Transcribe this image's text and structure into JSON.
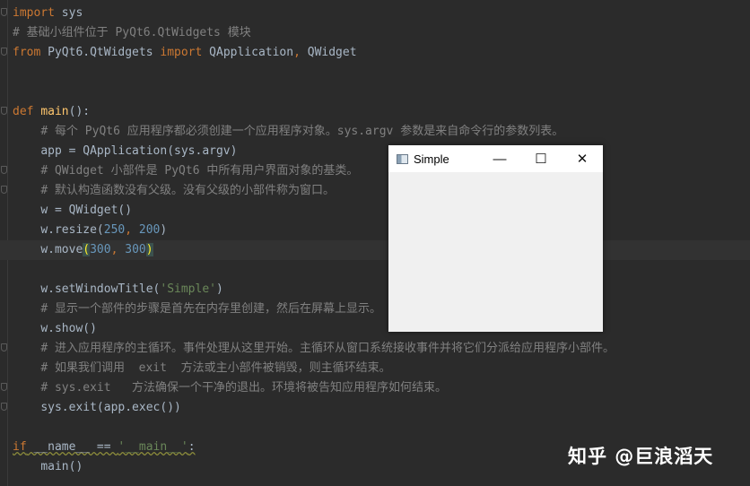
{
  "editor": {
    "lines": [
      {
        "indent": 0,
        "tokens": [
          [
            "import",
            "kw"
          ],
          [
            " sys",
            ""
          ]
        ]
      },
      {
        "indent": 0,
        "tokens": [
          [
            "# 基础小组件位于 PyQt6.QtWidgets 模块",
            "cm"
          ]
        ]
      },
      {
        "indent": 0,
        "tokens": [
          [
            "from",
            "kw"
          ],
          [
            " PyQt6.QtWidgets ",
            ""
          ],
          [
            "import",
            "kw"
          ],
          [
            " QApplication",
            ""
          ],
          [
            ",",
            "kw"
          ],
          [
            " QWidget",
            ""
          ]
        ]
      },
      {
        "indent": 0,
        "tokens": []
      },
      {
        "indent": 0,
        "tokens": []
      },
      {
        "indent": 0,
        "tokens": [
          [
            "def",
            "kw"
          ],
          [
            " ",
            ""
          ],
          [
            "main",
            "fn"
          ],
          [
            "():",
            ""
          ]
        ]
      },
      {
        "indent": 1,
        "tokens": [
          [
            "# 每个 PyQt6 应用程序都必须创建一个应用程序对象。sys.argv 参数是来自命令行的参数列表。",
            "cm"
          ]
        ]
      },
      {
        "indent": 1,
        "tokens": [
          [
            "app = QApplication(sys.argv)",
            ""
          ]
        ]
      },
      {
        "indent": 1,
        "tokens": [
          [
            "# QWidget 小部件是 PyQt6 中所有用户界面对象的基类。",
            "cm"
          ]
        ]
      },
      {
        "indent": 1,
        "tokens": [
          [
            "# 默认构造函数没有父级。没有父级的小部件称为窗口。",
            "cm"
          ]
        ]
      },
      {
        "indent": 1,
        "tokens": [
          [
            "w = QWidget()",
            ""
          ]
        ]
      },
      {
        "indent": 1,
        "tokens": [
          [
            "w.resize(",
            ""
          ],
          [
            "250",
            "num"
          ],
          [
            ", ",
            "kw"
          ],
          [
            "200",
            "num"
          ],
          [
            ")",
            ""
          ]
        ]
      },
      {
        "indent": 1,
        "current": true,
        "tokens": [
          [
            "w.move",
            ""
          ],
          [
            "(",
            "br"
          ],
          [
            "300",
            "num"
          ],
          [
            ", ",
            "kw"
          ],
          [
            "300",
            "num"
          ],
          [
            ")",
            "br"
          ]
        ]
      },
      {
        "indent": 0,
        "tokens": []
      },
      {
        "indent": 1,
        "tokens": [
          [
            "w.setWindowTitle(",
            ""
          ],
          [
            "'Simple'",
            "str"
          ],
          [
            ")",
            ""
          ]
        ]
      },
      {
        "indent": 1,
        "tokens": [
          [
            "# 显示一个部件的步骤是首先在内存里创建，然后在屏幕上显示。",
            "cm"
          ]
        ]
      },
      {
        "indent": 1,
        "tokens": [
          [
            "w.show()",
            ""
          ]
        ]
      },
      {
        "indent": 1,
        "tokens": [
          [
            "# 进入应用程序的主循环。事件处理从这里开始。主循环从窗口系统接收事件并将它们分派给应用程序小部件。",
            "cm"
          ]
        ]
      },
      {
        "indent": 1,
        "tokens": [
          [
            "# 如果我们调用  exit  方法或主小部件被销毁，则主循环结束。",
            "cm"
          ]
        ]
      },
      {
        "indent": 1,
        "tokens": [
          [
            "# sys.exit   方法确保一个干净的退出。环境将被告知应用程序如何结束。",
            "cm"
          ]
        ]
      },
      {
        "indent": 1,
        "tokens": [
          [
            "sys.exit(app.exec())",
            ""
          ]
        ]
      },
      {
        "indent": 0,
        "tokens": []
      },
      {
        "indent": 0,
        "wavy": true,
        "tokens": [
          [
            "if",
            "kw"
          ],
          [
            " __name__ == ",
            ""
          ],
          [
            "'__main__'",
            "str"
          ],
          [
            ":",
            ""
          ]
        ]
      },
      {
        "indent": 1,
        "tokens": [
          [
            "main()",
            ""
          ]
        ]
      }
    ]
  },
  "window": {
    "title": "Simple",
    "minimize": "—",
    "maximize": "☐",
    "close": "✕"
  },
  "watermark": "知乎 @巨浪滔天"
}
